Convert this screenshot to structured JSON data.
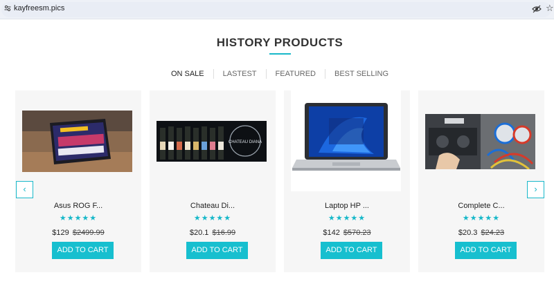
{
  "browser": {
    "url": "kayfreesm.pics"
  },
  "section": {
    "title": "HISTORY PRODUCTS"
  },
  "tabs": [
    {
      "label": "ON SALE",
      "active": true
    },
    {
      "label": "LASTEST",
      "active": false
    },
    {
      "label": "FEATURED",
      "active": false
    },
    {
      "label": "BEST SELLING",
      "active": false
    }
  ],
  "nav": {
    "prev": "‹",
    "next": "›"
  },
  "products": [
    {
      "name": "Asus ROG F...",
      "rating": "★★★★★",
      "price": "$129",
      "old_price": "$2499.99",
      "cta": "ADD TO CART",
      "image": "tablet-product-image"
    },
    {
      "name": "Chateau Di...",
      "rating": "★★★★★",
      "price": "$20.1",
      "old_price": "$16.99",
      "cta": "ADD TO CART",
      "image": "wine-bottles-banner-image",
      "banner_text": "CHATEAU DIANA"
    },
    {
      "name": "Laptop HP ...",
      "rating": "★★★★★",
      "price": "$142",
      "old_price": "$570.23",
      "cta": "ADD TO CART",
      "image": "laptop-product-image"
    },
    {
      "name": "Complete C...",
      "rating": "★★★★★",
      "price": "$20.3",
      "old_price": "$24.23",
      "cta": "ADD TO CART",
      "image": "car-ac-gauges-image"
    }
  ],
  "colors": {
    "accent": "#17bfcf",
    "card_bg": "#f6f6f6"
  }
}
